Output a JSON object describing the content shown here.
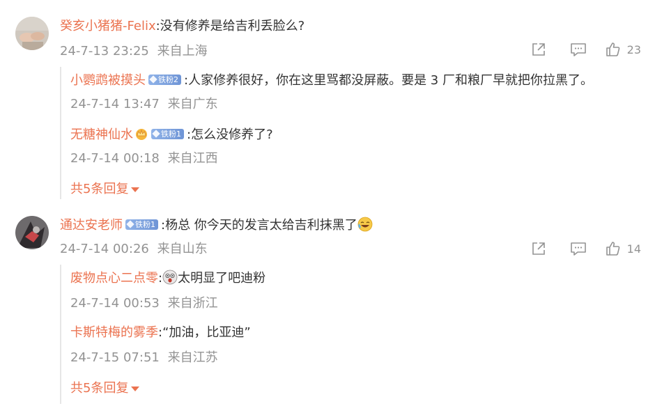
{
  "comments": [
    {
      "user": "癸亥小猪猪-Felix",
      "text": ":没有修养是给吉利丢脸么?",
      "time": "24-7-13 23:25",
      "location": "来自上海",
      "likes": "23",
      "replies": [
        {
          "user": "小鹦鹉被摸头",
          "badge": "铁粉2",
          "text": ":人家修养很好，你在这里骂都没屏蔽。要是 3 厂和粮厂早就把你拉黑了。",
          "time": "24-7-14 13:47",
          "location": "来自广东"
        },
        {
          "user": "无糖神仙水",
          "badge": "铁粉1",
          "text": ":怎么没修养了?",
          "time": "24-7-14 00:18",
          "location": "来自江西"
        }
      ],
      "more": "共5条回复"
    },
    {
      "user": "通达安老师",
      "badge": "铁粉1",
      "text": ":杨总  你今天的发言太给吉利抹黑了",
      "time": "24-7-14 00:26",
      "location": "来自山东",
      "likes": "14",
      "replies": [
        {
          "user": "废物点心二点零",
          "text": "太明显了吧迪粉",
          "time": "24-7-14 00:53",
          "location": "来自浙江"
        },
        {
          "user": "卡斯特梅的雾季",
          "text": ":“加油，比亚迪”",
          "time": "24-7-15 07:51",
          "location": "来自江苏"
        }
      ],
      "more": "共5条回复"
    }
  ],
  "icons": {
    "share": "share-icon",
    "comment": "comment-icon",
    "like": "thumbs-up-icon",
    "more_arrow": "caret-down-icon",
    "crown": "crown-icon",
    "laugh_cry": "laugh-cry-emoji-icon",
    "shocked": "shocked-face-emoji-icon"
  },
  "colors": {
    "username": "#eb7350",
    "meta": "#939393",
    "text": "#333333",
    "badge": "#7aa0dc"
  }
}
